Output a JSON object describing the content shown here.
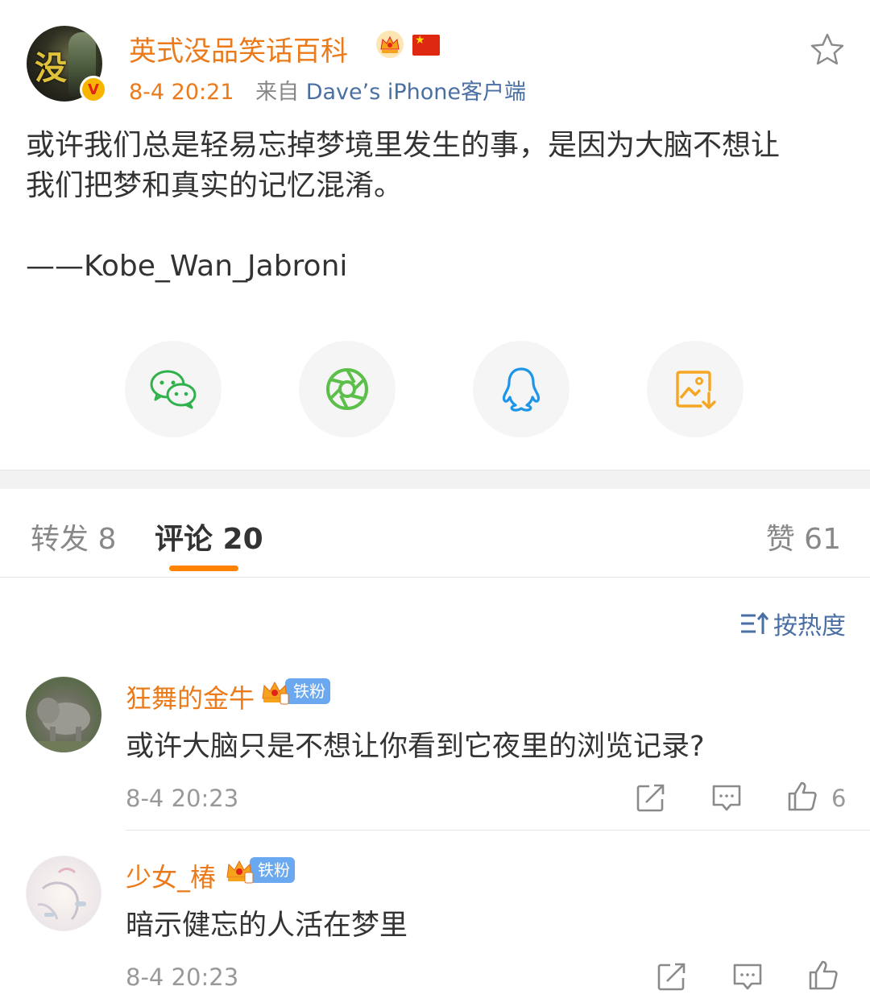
{
  "post": {
    "author_name": "英式没品笑话百科",
    "time": "8-4 20:21",
    "from_label": "来自",
    "device": "Dave’s iPhone客户端",
    "body": "或许我们总是轻易忘掉梦境里发生的事，是因为大脑不想让\n我们把梦和真实的记忆混淆。",
    "signature": "——Kobe_Wan_Jabroni",
    "avatar_text": "没"
  },
  "share": {
    "icons": [
      "wechat-icon",
      "moments-icon",
      "qq-icon",
      "save-image-icon"
    ]
  },
  "tabs": {
    "repost": "转发 8",
    "comment": "评论 20",
    "like": "赞 61"
  },
  "sort": {
    "label": "按热度"
  },
  "comments": [
    {
      "name": "狂舞的金牛",
      "badge": "铁粉",
      "text": "或许大脑只是不想让你看到它夜里的浏览记录?",
      "time": "8-4 20:23",
      "likes": "6"
    },
    {
      "name": "少女_椿",
      "badge": "铁粉",
      "text": "暗示健忘的人活在梦里",
      "time": "8-4 20:23",
      "likes": ""
    }
  ],
  "colors": {
    "accent": "#ff8200",
    "name": "#eb7a1a",
    "link": "#4a6fa5",
    "badge": "#6aa8ef"
  }
}
